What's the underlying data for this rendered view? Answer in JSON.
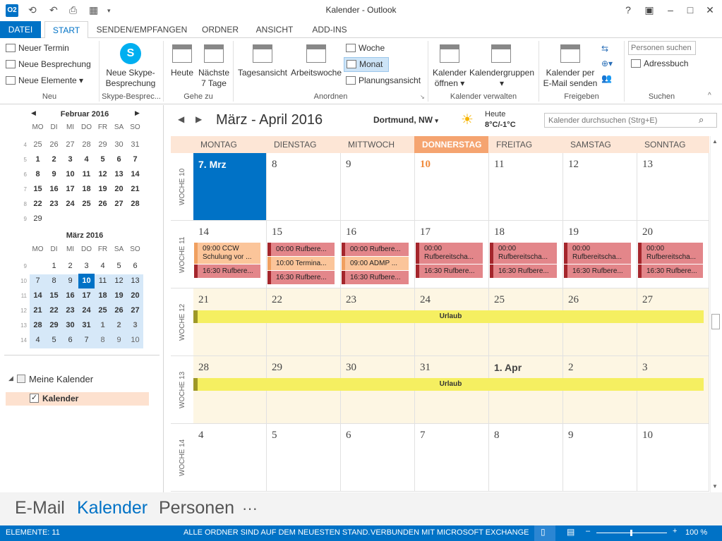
{
  "window": {
    "title": "Kalender - Outlook",
    "logo": "O2"
  },
  "tabs": [
    "DATEI",
    "START",
    "SENDEN/EMPFANGEN",
    "ORDNER",
    "ANSICHT",
    "ADD-INS"
  ],
  "ribbon": {
    "neu": {
      "neuer_termin": "Neuer Termin",
      "neue_besprechung": "Neue Besprechung",
      "neue_elemente": "Neue Elemente",
      "label": "Neu"
    },
    "skype": {
      "line1": "Neue Skype-",
      "line2": "Besprechung",
      "label": "Skype-Besprec..."
    },
    "gehezu": {
      "heute": "Heute",
      "naechste1": "Nächste",
      "naechste2": "7 Tage",
      "label": "Gehe zu"
    },
    "anordnen": {
      "tagesansicht": "Tagesansicht",
      "arbeitswoche": "Arbeitswoche",
      "woche": "Woche",
      "monat": "Monat",
      "planung": "Planungsansicht",
      "label": "Anordnen"
    },
    "verwalten": {
      "oeffnen1": "Kalender",
      "oeffnen2": "öffnen",
      "gruppen": "Kalendergruppen",
      "label": "Kalender verwalten"
    },
    "freigeben": {
      "line1": "Kalender per",
      "line2": "E-Mail senden",
      "label": "Freigeben"
    },
    "suchen": {
      "placeholder": "Personen suchen",
      "adressbuch": "Adressbuch",
      "label": "Suchen"
    }
  },
  "mini_feb": {
    "title": "Februar 2016",
    "dow": [
      "MO",
      "DI",
      "MI",
      "DO",
      "FR",
      "SA",
      "SO"
    ],
    "rows": [
      {
        "wk": "4",
        "days": [
          "25",
          "26",
          "27",
          "28",
          "29",
          "30",
          "31"
        ]
      },
      {
        "wk": "5",
        "days": [
          "1",
          "2",
          "3",
          "4",
          "5",
          "6",
          "7"
        ]
      },
      {
        "wk": "6",
        "days": [
          "8",
          "9",
          "10",
          "11",
          "12",
          "13",
          "14"
        ]
      },
      {
        "wk": "7",
        "days": [
          "15",
          "16",
          "17",
          "18",
          "19",
          "20",
          "21"
        ]
      },
      {
        "wk": "8",
        "days": [
          "22",
          "23",
          "24",
          "25",
          "26",
          "27",
          "28"
        ]
      },
      {
        "wk": "9",
        "days": [
          "29",
          "",
          "",
          "",
          "",
          "",
          ""
        ]
      }
    ]
  },
  "mini_mar": {
    "title": "März 2016",
    "dow": [
      "MO",
      "DI",
      "MI",
      "DO",
      "FR",
      "SA",
      "SO"
    ],
    "rows": [
      {
        "wk": "9",
        "days": [
          "",
          "1",
          "2",
          "3",
          "4",
          "5",
          "6"
        ]
      },
      {
        "wk": "10",
        "days": [
          "7",
          "8",
          "9",
          "10",
          "11",
          "12",
          "13"
        ]
      },
      {
        "wk": "11",
        "days": [
          "14",
          "15",
          "16",
          "17",
          "18",
          "19",
          "20"
        ]
      },
      {
        "wk": "12",
        "days": [
          "21",
          "22",
          "23",
          "24",
          "25",
          "26",
          "27"
        ]
      },
      {
        "wk": "13",
        "days": [
          "28",
          "29",
          "30",
          "31",
          "1",
          "2",
          "3"
        ]
      },
      {
        "wk": "14",
        "days": [
          "4",
          "5",
          "6",
          "7",
          "8",
          "9",
          "10"
        ]
      }
    ]
  },
  "folders": {
    "meine": "Meine Kalender",
    "kalender": "Kalender"
  },
  "calendar": {
    "title": "März - April 2016",
    "location": "Dortmund, NW",
    "weather_label": "Heute",
    "weather_temp": "8°C/-1°C",
    "search_placeholder": "Kalender durchsuchen (Strg+E)",
    "dow": [
      "MONTAG",
      "DIENSTAG",
      "MITTWOCH",
      "DONNERSTAG",
      "FREITAG",
      "SAMSTAG",
      "SONNTAG"
    ],
    "weeks": [
      {
        "label": "WOCHE 10",
        "days": [
          "7. Mrz",
          "8",
          "9",
          "10",
          "11",
          "12",
          "13"
        ]
      },
      {
        "label": "WOCHE 11",
        "days": [
          "14",
          "15",
          "16",
          "17",
          "18",
          "19",
          "20"
        ]
      },
      {
        "label": "WOCHE 12",
        "days": [
          "21",
          "22",
          "23",
          "24",
          "25",
          "26",
          "27"
        ]
      },
      {
        "label": "WOCHE 13",
        "days": [
          "28",
          "29",
          "30",
          "31",
          "1. Apr",
          "2",
          "3"
        ]
      },
      {
        "label": "WOCHE 14",
        "days": [
          "4",
          "5",
          "6",
          "7",
          "8",
          "9",
          "10"
        ]
      }
    ],
    "events_w11": [
      [
        {
          "t": "09:00 CCW Schulung vor ...",
          "c": "or",
          "two": true
        },
        {
          "t": "16:30 Rufbere...",
          "c": "red"
        }
      ],
      [
        {
          "t": "00:00 Rufbere...",
          "c": "red"
        },
        {
          "t": "10:00 Termina...",
          "c": "or"
        },
        {
          "t": "16:30 Rufbere...",
          "c": "red"
        }
      ],
      [
        {
          "t": "00:00 Rufbere...",
          "c": "red"
        },
        {
          "t": "09:00 ADMP ...",
          "c": "or"
        },
        {
          "t": "16:30 Rufbere...",
          "c": "red"
        }
      ],
      [
        {
          "t": "00:00 Rufbereitscha...",
          "c": "red",
          "two": true
        },
        {
          "t": "16:30 Rufbere...",
          "c": "red"
        }
      ],
      [
        {
          "t": "00:00 Rufbereitscha...",
          "c": "red",
          "two": true
        },
        {
          "t": "16:30 Rufbere...",
          "c": "red"
        }
      ],
      [
        {
          "t": "00:00 Rufbereitscha...",
          "c": "red",
          "two": true
        },
        {
          "t": "16:30 Rufbere...",
          "c": "red"
        }
      ],
      [
        {
          "t": "00:00 Rufbereitscha...",
          "c": "red",
          "two": true
        },
        {
          "t": "16:30 Rufbere...",
          "c": "red"
        }
      ]
    ],
    "urlaub": "Urlaub"
  },
  "nav": {
    "email": "E-Mail",
    "kalender": "Kalender",
    "personen": "Personen",
    "more": "···"
  },
  "status": {
    "elemente": "ELEMENTE: 11",
    "ordner": "ALLE ORDNER SIND AUF DEM NEUESTEN STAND.",
    "verbunden": "VERBUNDEN MIT MICROSOFT EXCHANGE",
    "zoom": "100 %"
  },
  "colors": {
    "accent": "#0072c6",
    "today": "#f5a470",
    "event_red": "#e3868a",
    "event_orange": "#fbc59a",
    "urlaub": "#f5ef61"
  }
}
